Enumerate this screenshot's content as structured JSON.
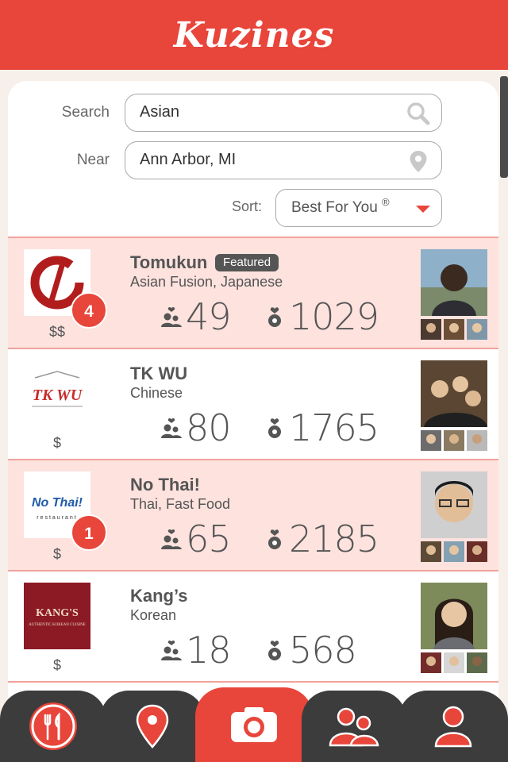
{
  "app": {
    "title": "Kuzines"
  },
  "search": {
    "label": "Search",
    "value": "Asian"
  },
  "near": {
    "label": "Near",
    "value": "Ann Arbor, MI"
  },
  "sort": {
    "label": "Sort:",
    "value": "Best For You",
    "mark": "®"
  },
  "colors": {
    "accent": "#e8453b",
    "featured_row": "#fde2de",
    "tab_dark": "#3c3c3c"
  },
  "restaurants": [
    {
      "name": "Tomukun",
      "tag": "Featured",
      "cuisine": "Asian Fusion, Japanese",
      "price": "$$",
      "badge": "4",
      "friends": "49",
      "likes": "1029",
      "featured": true
    },
    {
      "name": "TK WU",
      "tag": "",
      "cuisine": "Chinese",
      "price": "$",
      "badge": "",
      "friends": "80",
      "likes": "1765",
      "featured": false
    },
    {
      "name": "No Thai!",
      "tag": "",
      "cuisine": "Thai, Fast Food",
      "price": "$",
      "badge": "1",
      "friends": "65",
      "likes": "2185",
      "featured": true
    },
    {
      "name": "Kang’s",
      "tag": "",
      "cuisine": "Korean",
      "price": "$",
      "badge": "",
      "friends": "18",
      "likes": "568",
      "featured": false
    }
  ],
  "logos": {
    "tkwu": "TK WU",
    "nothai": "No Thai!",
    "nothai_sub": "restaurant",
    "kangs": "KANG'S",
    "kangs_sub": "AUTHENTIC KOREAN CUISINE"
  },
  "tabs": [
    {
      "icon": "fork-knife-icon"
    },
    {
      "icon": "map-pin-icon"
    },
    {
      "icon": "camera-icon"
    },
    {
      "icon": "group-icon"
    },
    {
      "icon": "user-icon"
    }
  ]
}
